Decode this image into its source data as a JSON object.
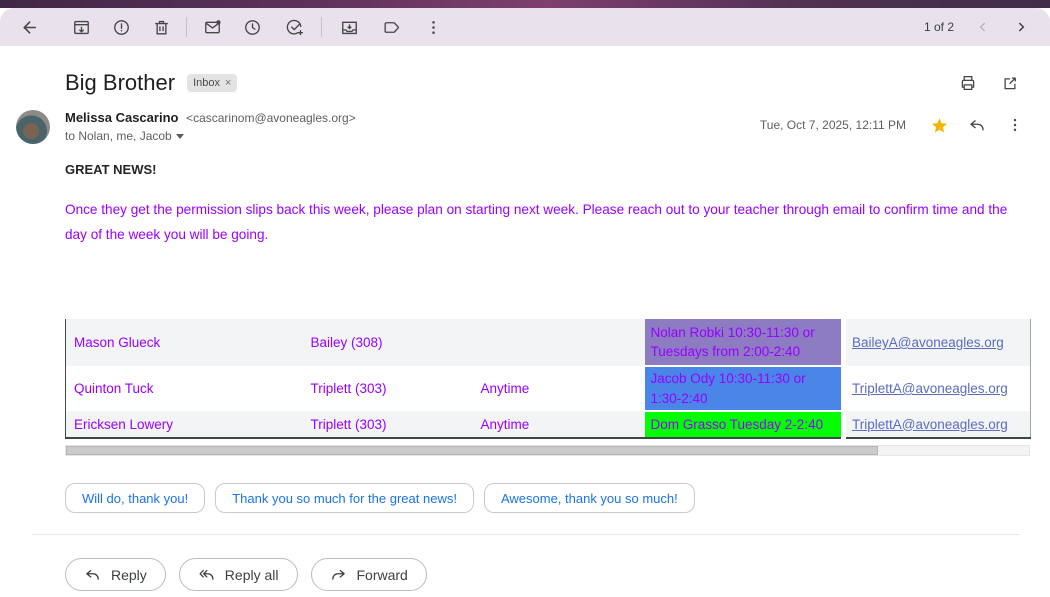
{
  "window": {
    "pagination": "1 of 2",
    "toolbar_icons": [
      "back-arrow",
      "archive",
      "report-spam",
      "delete",
      "mark-unread",
      "snooze",
      "add-to-tasks",
      "move-to",
      "labels",
      "more-options"
    ]
  },
  "header": {
    "subject": "Big Brother",
    "label": "Inbox",
    "label_close": "×",
    "icons": [
      "print",
      "open-in-new"
    ]
  },
  "message": {
    "sender_name": "Melissa Cascarino",
    "sender_address": "<cascarinom@avoneagles.org>",
    "recipients": "to Nolan, me, Jacob",
    "date": "Tue, Oct 7, 2025, 12:11 PM",
    "starred": true,
    "greeting": "GREAT NEWS!",
    "body": "Once they  get the permission slips back this week, please plan on starting next week. Please reach out to your teacher through email to confirm time and  the day of the week you will be going."
  },
  "table": {
    "rows": [
      {
        "name": "Mason Glueck",
        "teacher": "Bailey (308)",
        "availability": "",
        "match": "Nolan Robki 10:30-11:30 or Tuesdays from 2:00-2:40",
        "match_bg": "#8e7cc3",
        "email": "BaileyA@avoneagles.org"
      },
      {
        "name": "Quinton Tuck",
        "teacher": "Triplett (303)",
        "availability": "Anytime",
        "match": "Jacob Ody 10:30-11:30 or 1:30-2:40",
        "match_bg": "#4a86e8",
        "email": "TriplettA@avoneagles.org"
      },
      {
        "name": "Ericksen Lowery",
        "teacher": "Triplett (303)",
        "availability": "Anytime",
        "match": "Dom Grasso Tuesday 2-2:40",
        "match_bg": "#00ff00",
        "email": "TriplettA@avoneagles.org"
      }
    ]
  },
  "smart_replies": [
    "Will do, thank you!",
    "Thank you so much for the great news!",
    "Awesome, thank you so much!"
  ],
  "actions": {
    "reply": "Reply",
    "reply_all": "Reply all",
    "forward": "Forward"
  },
  "colors": {
    "accent_purple_text": "#9900ff",
    "match_purple": "#8e7cc3",
    "match_blue": "#4a86e8",
    "match_green": "#00ff00",
    "link_blue": "#5a6cc0",
    "smart_reply_blue": "#1a73e8",
    "star_yellow": "#f4b400"
  }
}
